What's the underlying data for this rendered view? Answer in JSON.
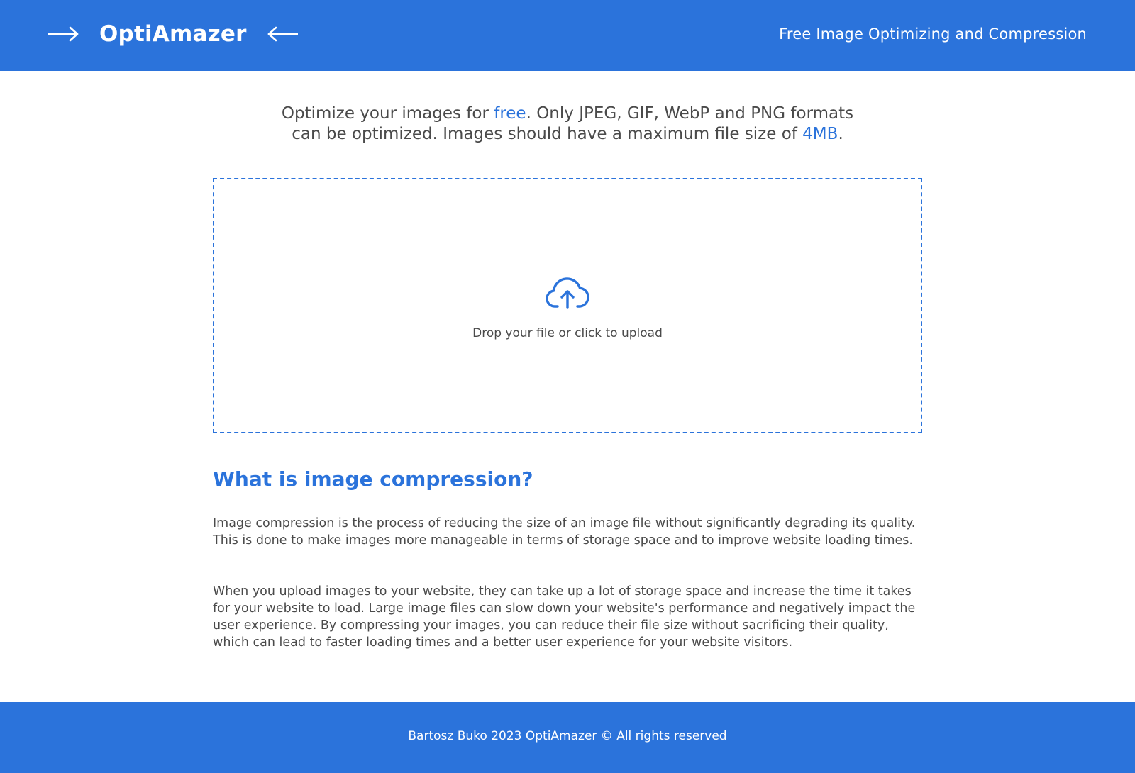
{
  "header": {
    "logo_text": "OptiAmazer",
    "tagline": "Free Image Optimizing and Compression",
    "icons": [
      "arrow-right-icon",
      "arrow-left-icon"
    ]
  },
  "intro": {
    "part1": "Optimize your images for ",
    "free": "free",
    "part2": ". Only JPEG, GIF, WebP and PNG formats can be optimized. Images should have a maximum file size of ",
    "size": "4MB",
    "part3": "."
  },
  "upload": {
    "icon": "cloud-upload-icon",
    "label": "Drop your file or click to upload"
  },
  "section": {
    "heading": "What is image compression?",
    "paragraph1": "Image compression is the process of reducing the size of an image file without significantly degrading its quality. This is done to make images more manageable in terms of storage space and to improve website loading times.",
    "paragraph2": "When you upload images to your website, they can take up a lot of storage space and increase the time it takes for your website to load. Large image files can slow down your website's performance and negatively impact the user experience. By compressing your images, you can reduce their file size without sacrificing their quality, which can lead to faster loading times and a better user experience for your website visitors."
  },
  "footer": {
    "text": "Bartosz Buko 2023 OptiAmazer © All rights reserved"
  },
  "colors": {
    "accent": "#2b73db",
    "text": "#4a4a4a",
    "background": "#ffffff"
  }
}
